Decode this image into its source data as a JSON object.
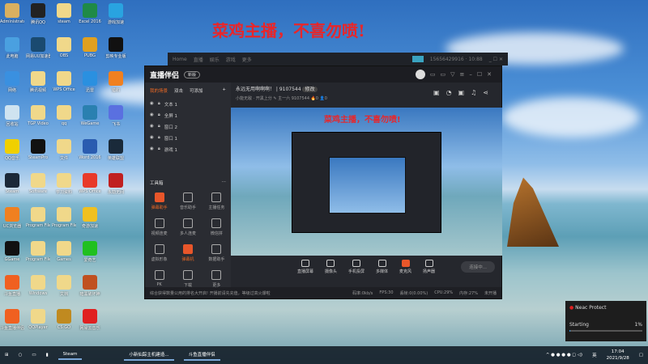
{
  "banner": "菜鸡主播，不喜勿喷!",
  "desktop_icons": [
    [
      "Administrator",
      "#d9b060"
    ],
    [
      "腾讯QQ",
      "#222"
    ],
    [
      "steam",
      "#f0d88a"
    ],
    [
      "Excel 2016",
      "#1f8a47"
    ],
    [
      "游戏加速",
      "#29a3e0"
    ],
    [
      "此电脑",
      "#4aa0e0"
    ],
    [
      "网易UU加速器",
      "#1a4a70"
    ],
    [
      "OBS",
      "#f0d88a"
    ],
    [
      "PUBG",
      "#e0a020"
    ],
    [
      "剪映专业版",
      "#111"
    ],
    [
      "网络",
      "#3a90e0"
    ],
    [
      "腾讯视频",
      "#f0d88a"
    ],
    [
      "WPS Office",
      "#f0d88a"
    ],
    [
      "迅雷",
      "#2a90e0"
    ],
    [
      "猎豹",
      "#f08020"
    ],
    [
      "回收站",
      "#cfe3f0"
    ],
    [
      "TGP Video",
      "#f0d88a"
    ],
    [
      "qq",
      "#f0d88a"
    ],
    [
      "WeGame",
      "#2a80b0"
    ],
    [
      "飞书",
      "#5a70e0"
    ],
    [
      "QQ音乐",
      "#f0d000"
    ],
    [
      "SteamPro",
      "#111"
    ],
    [
      "文件",
      "#f0d88a"
    ],
    [
      "Word 2016",
      "#2a5cb0"
    ],
    [
      "英雄联盟",
      "#1a2a3a"
    ],
    [
      "Steam",
      "#1b2838"
    ],
    [
      "Software",
      "#f0d88a"
    ],
    [
      "学习资料",
      "#f0d88a"
    ],
    [
      "WPS Office",
      "#e83a2a"
    ],
    [
      "永劫无间",
      "#c02020"
    ],
    [
      "UC浏览器",
      "#f08020"
    ],
    [
      "Program Files",
      "#f0d88a"
    ],
    [
      "Program Files (x86)",
      "#f0d88a"
    ],
    [
      "奇游加速",
      "#f0c020"
    ],
    [
      "",
      "#0000"
    ],
    [
      "GGame",
      "#111"
    ],
    [
      "Program Files",
      "#f0d88a"
    ],
    [
      "Games",
      "#f0d88a"
    ],
    [
      "爱奇艺",
      "#20c020"
    ],
    [
      "",
      "#0000"
    ],
    [
      "斗鱼直播",
      "#f06020"
    ],
    [
      "Windows",
      "#f0d88a"
    ],
    [
      "文档",
      "#f0d88a"
    ],
    [
      "暗黑破坏神",
      "#c05020"
    ],
    [
      "",
      "#0000"
    ],
    [
      "斗鱼直播伴侣",
      "#f06020"
    ],
    [
      "QQPlayer",
      "#f0d88a"
    ],
    [
      "CS:GO",
      "#c08a20"
    ],
    [
      "网易云音乐",
      "#e02020"
    ],
    [
      "",
      "#0000"
    ]
  ],
  "back_window": {
    "menu": [
      "Home",
      "直播",
      "娱乐",
      "游戏",
      "更多"
    ],
    "user": "15656429916 · 10:88"
  },
  "app": {
    "logo": "直播伴侣",
    "version": "新版",
    "scene_tabs": [
      "我的场景",
      "双击",
      "可添加"
    ],
    "sources": [
      "文本 1",
      "全屏 1",
      "窗口 2",
      "窗口 1",
      "游戏 1"
    ],
    "toolbox_label": "工具箱",
    "tools": [
      "弹幕助手",
      "音乐助手",
      "主播任务",
      "视频连麦",
      "多人连麦",
      "微信拼",
      "虚拟形象",
      "弹幕机",
      "数据助手",
      "PK",
      "下载",
      "更多"
    ],
    "room_title": "永远无用啊啊啊！ | 9107544",
    "edit_badge": "修改",
    "room_sub": "小能无敌 · 开黑上分 ✎   主一六  9107544  🔥0  👤0",
    "preview_title": "菜鸡主播，不喜勿喷!",
    "controls": [
      "直播屏幕",
      "摄像头",
      "手机投屏",
      "多媒体",
      "麦克风",
      "扬声器"
    ],
    "live_button": "连接中...",
    "notice": "综合获得数量公用的排名大开启! 开播前请先充值，等级过高火爆啦",
    "stats": [
      "码率:0kb/s",
      "FPS:30",
      "丢帧:0(0.00%)",
      "CPU:29%",
      "内存:27%",
      "未开播"
    ]
  },
  "taskbar": {
    "tasks": [
      "Steam",
      "小新仙踪主机建造...",
      "斗鱼直播伴侣"
    ],
    "ime": "英",
    "time": "17:04",
    "date": "2021/9/28"
  },
  "toast": {
    "title": "Neac Protect",
    "status": "Starting",
    "percent": "1%",
    "progress": 0.01
  }
}
